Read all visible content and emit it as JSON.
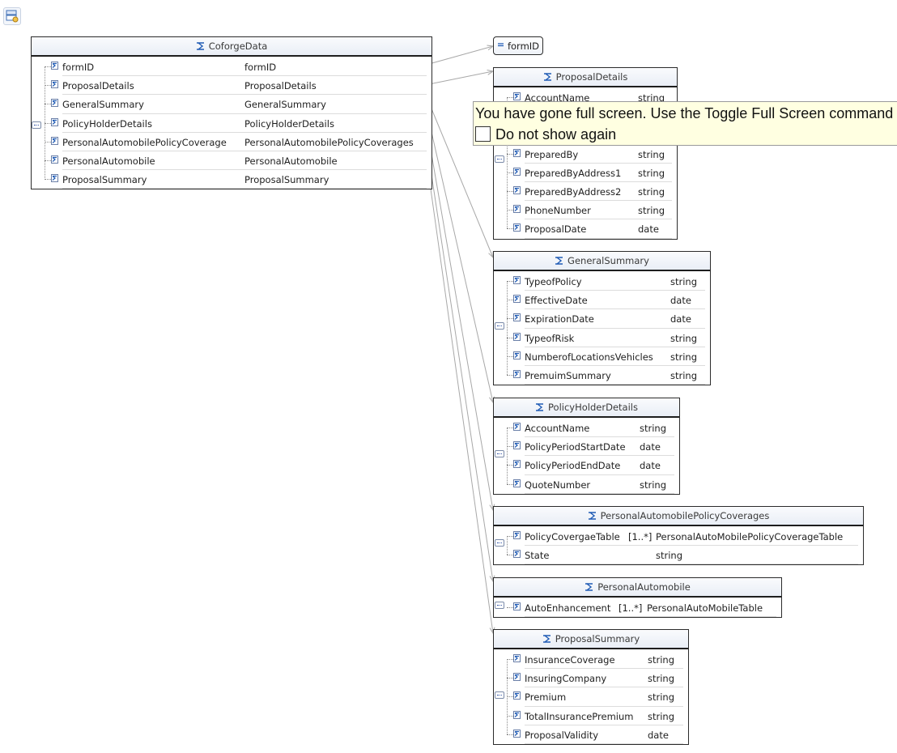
{
  "root": {
    "title": "CoforgeData",
    "rows": [
      {
        "name": "formID",
        "type": "formID"
      },
      {
        "name": "ProposalDetails",
        "type": "ProposalDetails"
      },
      {
        "name": "GeneralSummary",
        "type": "GeneralSummary"
      },
      {
        "name": "PolicyHolderDetails",
        "type": "PolicyHolderDetails"
      },
      {
        "name": "PersonalAutomobilePolicyCoverage",
        "type": "PersonalAutomobilePolicyCoverages"
      },
      {
        "name": "PersonalAutomobile",
        "type": "PersonalAutomobile"
      },
      {
        "name": "ProposalSummary",
        "type": "ProposalSummary"
      }
    ]
  },
  "formid_ref": {
    "label": "formID"
  },
  "types": [
    {
      "title": "ProposalDetails",
      "rows": [
        {
          "name": "AccountName",
          "type": "string"
        },
        {
          "name": "",
          "type": ""
        },
        {
          "name": "",
          "type": ""
        },
        {
          "name": "PreparedBy",
          "type": "string"
        },
        {
          "name": "PreparedByAddress1",
          "type": "string"
        },
        {
          "name": "PreparedByAddress2",
          "type": "string"
        },
        {
          "name": "PhoneNumber",
          "type": "string"
        },
        {
          "name": "ProposalDate",
          "type": "date"
        }
      ]
    },
    {
      "title": "GeneralSummary",
      "rows": [
        {
          "name": "TypeofPolicy",
          "type": "string"
        },
        {
          "name": "EffectiveDate",
          "type": "date"
        },
        {
          "name": "ExpirationDate",
          "type": "date"
        },
        {
          "name": "TypeofRisk",
          "type": "string"
        },
        {
          "name": "NumberofLocationsVehicles",
          "type": "string"
        },
        {
          "name": "PremuimSummary",
          "type": "string"
        }
      ]
    },
    {
      "title": "PolicyHolderDetails",
      "rows": [
        {
          "name": "AccountName",
          "type": "string"
        },
        {
          "name": "PolicyPeriodStartDate",
          "type": "date"
        },
        {
          "name": "PolicyPeriodEndDate",
          "type": "date"
        },
        {
          "name": "QuoteNumber",
          "type": "string"
        }
      ]
    },
    {
      "title": "PersonalAutomobilePolicyCoverages",
      "rows": [
        {
          "name": "PolicyCovergaeTable",
          "mult": "[1..*]",
          "type": "PersonalAutoMobilePolicyCoverageTable"
        },
        {
          "name": "State",
          "mult": "",
          "type": "string"
        }
      ]
    },
    {
      "title": "PersonalAutomobile",
      "rows": [
        {
          "name": "AutoEnhancement",
          "mult": "[1..*]",
          "type": "PersonalAutoMobileTable"
        }
      ]
    },
    {
      "title": "ProposalSummary",
      "rows": [
        {
          "name": "InsuranceCoverage",
          "type": "string"
        },
        {
          "name": "InsuringCompany",
          "type": "string"
        },
        {
          "name": "Premium",
          "type": "string"
        },
        {
          "name": "TotalInsurancePremium",
          "type": "string"
        },
        {
          "name": "ProposalValidity",
          "type": "date"
        }
      ]
    }
  ],
  "toast": {
    "message": "You have gone full screen. Use the Toggle Full Screen command (A",
    "checkbox_label": "Do not show again"
  },
  "colors": {
    "element_icon": "#1f5bb5",
    "link_line": "#a8a8a8"
  }
}
